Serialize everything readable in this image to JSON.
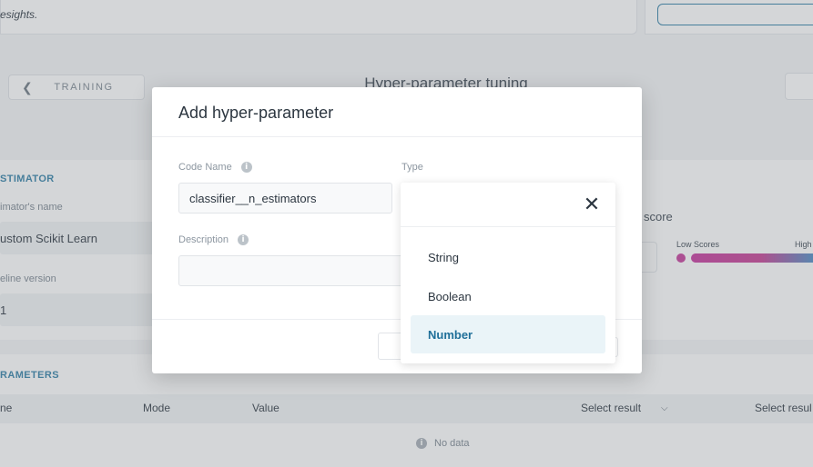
{
  "background": {
    "insights_text": "esights.",
    "back_button_label": "TRAINING",
    "page_title": "Hyper-parameter tuning",
    "estimator": {
      "section_label": "STIMATOR",
      "name_label": "imator's name",
      "name_value": "ustom Scikit Learn",
      "pipeline_label": "eline version",
      "pipeline_value": "1"
    },
    "score": {
      "title": "score",
      "low_label": "Low Scores",
      "high_label": "High"
    },
    "parameters": {
      "section_label": "RAMETERS",
      "columns": [
        "ne",
        "Mode",
        "Value",
        "Select result",
        "Select resul"
      ],
      "empty_text": "No data"
    }
  },
  "modal": {
    "title": "Add hyper-parameter",
    "code_name_label": "Code Name",
    "code_name_value": "classifier__n_estimators",
    "type_label": "Type",
    "description_label": "Description",
    "description_value": ""
  },
  "type_dropdown": {
    "options": [
      {
        "label": "String",
        "selected": false
      },
      {
        "label": "Boolean",
        "selected": false
      },
      {
        "label": "Number",
        "selected": true
      }
    ],
    "selected_value": "Number"
  },
  "colors": {
    "accent": "#2f7ea6",
    "selected_bg": "#eaf4f8",
    "low_score": "#c53a9a",
    "high_score": "#3f91c8"
  }
}
